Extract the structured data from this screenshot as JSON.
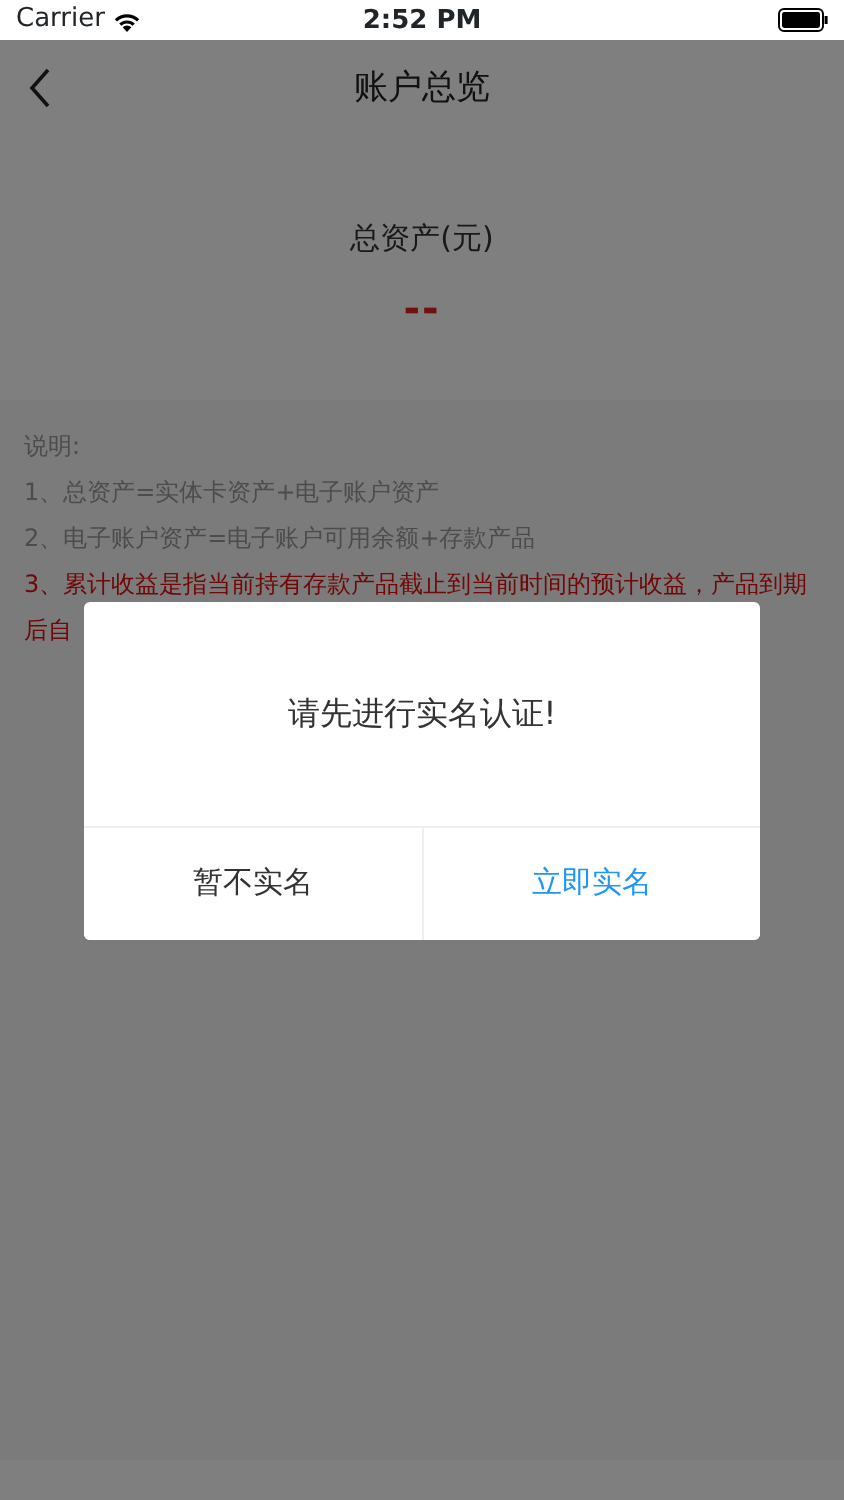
{
  "status_bar": {
    "carrier": "Carrier",
    "time": "2:52 PM"
  },
  "nav": {
    "title": "账户总览"
  },
  "summary": {
    "label": "总资产(元)",
    "value": "--"
  },
  "notes": [
    {
      "text": "说明:",
      "kind": "normal"
    },
    {
      "text": "1、总资产=实体卡资产+电子账户资产",
      "kind": "normal"
    },
    {
      "text": "2、电子账户资产=电子账户可用余额+存款产品",
      "kind": "normal"
    },
    {
      "text": "3、累计收益是指当前持有存款产品截止到当前时间的预计收益，产品到期后自",
      "kind": "highlight"
    }
  ],
  "dialog": {
    "message": "请先进行实名认证!",
    "buttons": [
      {
        "label": "暂不实名",
        "kind": "cancel"
      },
      {
        "label": "立即实名",
        "kind": "confirm"
      }
    ]
  }
}
